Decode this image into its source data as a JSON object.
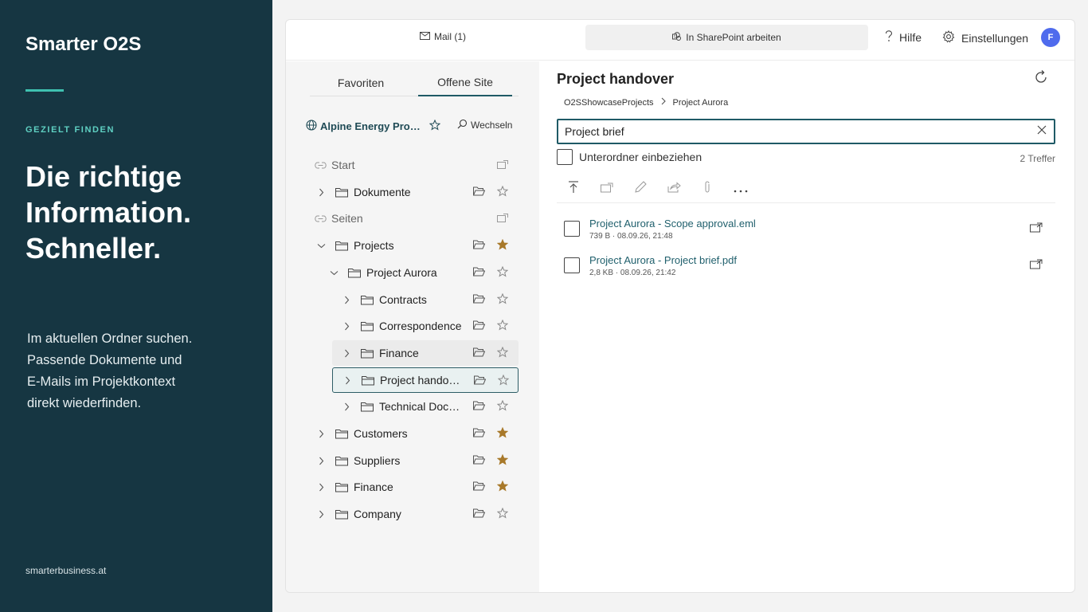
{
  "promo": {
    "brand": "Smarter O2S",
    "eyebrow": "GEZIELT FINDEN",
    "headline_1": "Die richtige",
    "headline_2": "Information.",
    "headline_3": "Schneller.",
    "body_1": "Im aktuellen Ordner suchen.",
    "body_2": "Passende Dokumente und",
    "body_3": "E-Mails im Projektkontext",
    "body_4": "direkt wiederfinden.",
    "footer": "smarterbusiness.at",
    "accent_color": "#3fc1b0",
    "background_color": "#163642"
  },
  "topbar": {
    "mail_label": "Mail (1)",
    "sharepoint_label": "In SharePoint arbeiten",
    "help_label": "Hilfe",
    "settings_label": "Einstellungen",
    "avatar_initial": "F",
    "avatar_color": "#4f6bed"
  },
  "nav": {
    "tab_favorites": "Favoriten",
    "tab_open_site": "Offene Site",
    "site_name": "Alpine Energy Projects",
    "switch_label": "Wechseln",
    "tree": [
      {
        "label": "Start",
        "type": "section"
      },
      {
        "label": "Dokumente",
        "type": "folder",
        "starred": false
      },
      {
        "label": "Seiten",
        "type": "section"
      },
      {
        "label": "Projects",
        "type": "folder",
        "expanded": true,
        "starred": true
      },
      {
        "label": "Project Aurora",
        "type": "folder",
        "expanded": true,
        "starred": false
      },
      {
        "label": "Contracts",
        "type": "folder",
        "starred": false
      },
      {
        "label": "Correspondence",
        "type": "folder",
        "starred": false
      },
      {
        "label": "Finance",
        "type": "folder",
        "starred": false,
        "hover": true
      },
      {
        "label": "Project handover",
        "type": "folder",
        "starred": false,
        "selected": true
      },
      {
        "label": "Technical Documentation",
        "type": "folder",
        "starred": false
      },
      {
        "label": "Customers",
        "type": "folder",
        "starred": true
      },
      {
        "label": "Suppliers",
        "type": "folder",
        "starred": true
      },
      {
        "label": "Finance",
        "type": "folder",
        "starred": true
      },
      {
        "label": "Company",
        "type": "folder",
        "starred": false
      }
    ],
    "star_color": "#a8792a"
  },
  "main": {
    "title": "Project handover",
    "breadcrumb_1": "O2SShowcaseProjects",
    "breadcrumb_2": "Project Aurora",
    "search_value": "Project brief",
    "subfolder_label": "Unterordner einbeziehen",
    "hits": "2 Treffer",
    "toolbar_icons": [
      "upload-icon",
      "move-icon",
      "rename-icon",
      "share-icon",
      "attach-icon",
      "more-icon"
    ],
    "files": [
      {
        "name": "Project Aurora - Scope approval.eml",
        "meta": "739 B · 08.09.26, 21:48"
      },
      {
        "name": "Project Aurora - Project brief.pdf",
        "meta": "2,8 KB · 08.09.26, 21:42"
      }
    ]
  }
}
